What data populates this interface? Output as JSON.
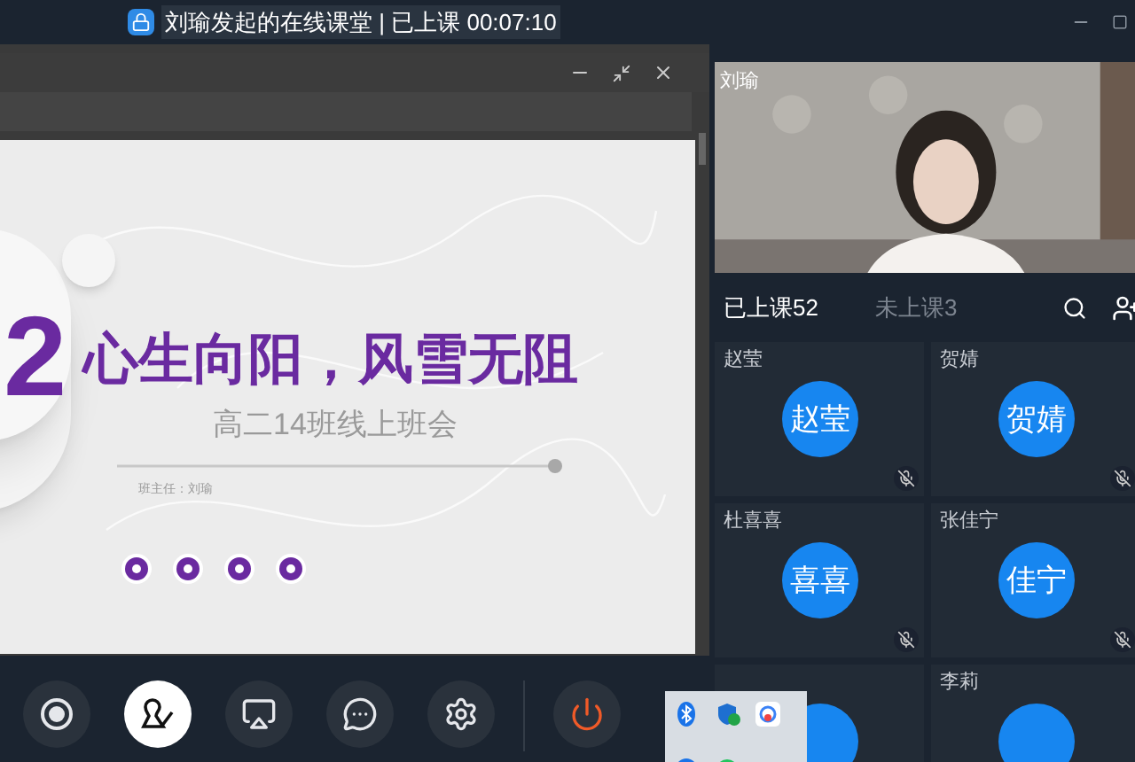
{
  "title_bar": {
    "title": "刘瑜发起的在线课堂 | 已上课 00:07:10"
  },
  "slide": {
    "big_number": "2",
    "title": "心生向阳，风雪无阻",
    "subtitle": "高二14班线上班会",
    "presenter": "班主任：刘瑜"
  },
  "video": {
    "name": "刘瑜"
  },
  "tabs": [
    {
      "label": "已上课52",
      "selected": true
    },
    {
      "label": "未上课3",
      "selected": false
    }
  ],
  "students": [
    {
      "name": "赵莹",
      "avatar": "赵莹",
      "muted": true
    },
    {
      "name": "贺婧",
      "avatar": "贺婧",
      "muted": true
    },
    {
      "name": "杜喜喜",
      "avatar": "喜喜",
      "muted": true
    },
    {
      "name": "张佳宁",
      "avatar": "佳宁",
      "muted": true
    }
  ],
  "bottom_students": [
    {
      "name": "李莉"
    }
  ],
  "toolbar": [
    {
      "kind": "record",
      "active": false
    },
    {
      "kind": "mute_all",
      "active": true
    },
    {
      "kind": "share",
      "active": false
    },
    {
      "kind": "messages",
      "active": false
    },
    {
      "kind": "settings",
      "active": false
    },
    {
      "kind": "end",
      "active": false
    }
  ]
}
